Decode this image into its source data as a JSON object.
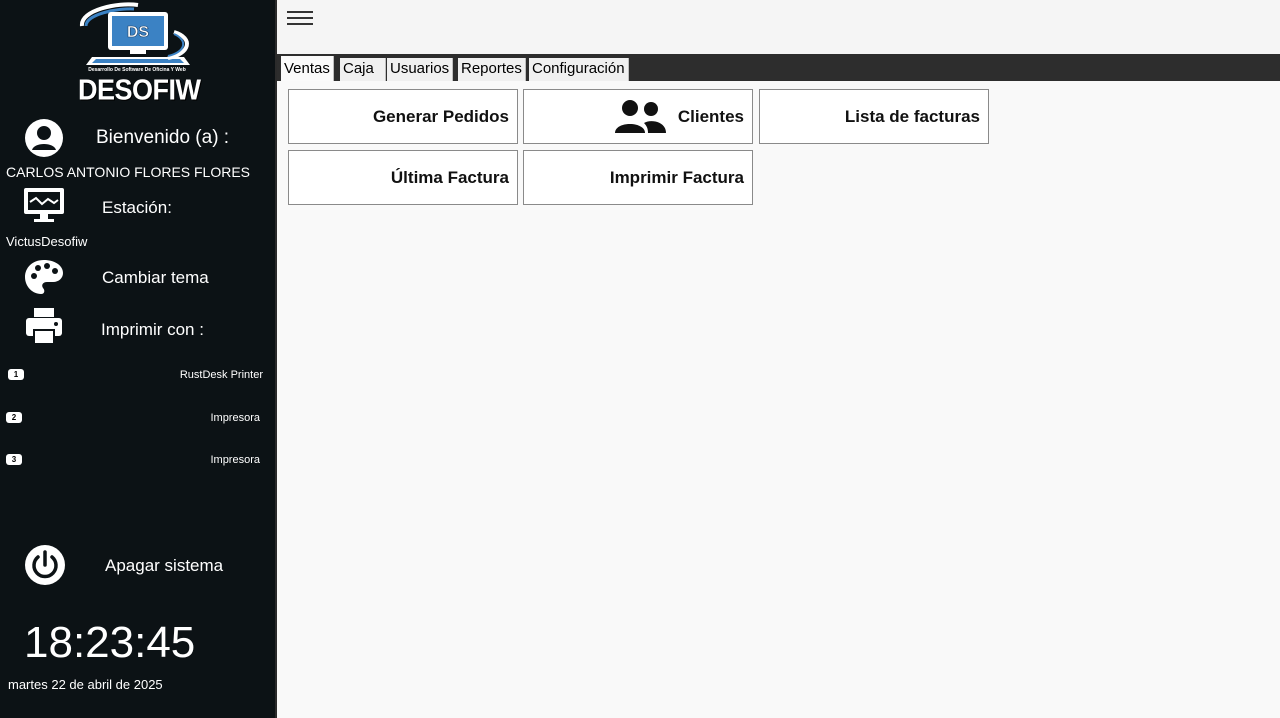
{
  "sidebar": {
    "logo": {
      "brand": "DESOFIW",
      "tagline": "Desarrollo De Software De Oficina Y Web",
      "badge": "DS"
    },
    "welcome_label": "Bienvenido (a) :",
    "user_name": "CARLOS ANTONIO FLORES FLORES",
    "station_label": "Estación:",
    "station_name": "VictusDesofiw",
    "theme_label": "Cambiar tema",
    "print_label": "Imprimir con :",
    "printers": [
      {
        "num": "1",
        "name": "RustDesk Printer"
      },
      {
        "num": "2",
        "name": "Impresora"
      },
      {
        "num": "3",
        "name": "Impresora"
      }
    ],
    "shutdown_label": "Apagar sistema",
    "clock": "18:23:45",
    "date": "martes 22 de abril de 2025"
  },
  "tabs": [
    {
      "label": "Ventas"
    },
    {
      "label": "Caja"
    },
    {
      "label": "Usuarios"
    },
    {
      "label": "Reportes"
    },
    {
      "label": "Configuración"
    }
  ],
  "buttons": {
    "generar_pedidos": "Generar Pedidos",
    "clientes": "Clientes",
    "lista_facturas": "Lista de facturas",
    "ultima_factura": "Última Factura",
    "imprimir_factura": "Imprimir Factura"
  },
  "colors": {
    "sidebar_bg": "#0c1215",
    "logo_blue": "#3b82c4"
  }
}
